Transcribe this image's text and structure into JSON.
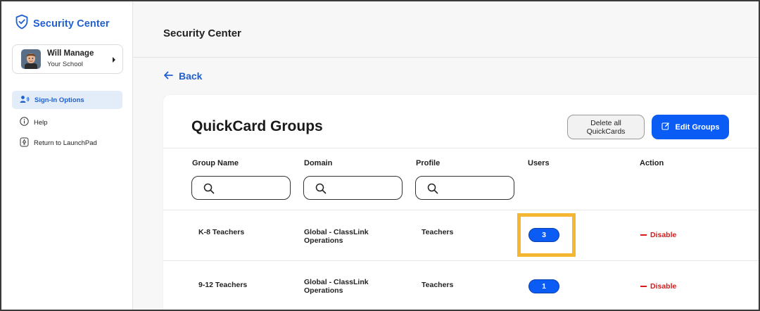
{
  "app": {
    "brand": "Security Center"
  },
  "user": {
    "name": "Will Manage",
    "school": "Your School"
  },
  "sidebar": {
    "items": [
      {
        "label": "Sign-In Options",
        "icon": "users-signin-icon",
        "active": true
      },
      {
        "label": "Help",
        "icon": "info-icon",
        "active": false
      },
      {
        "label": "Return to LaunchPad",
        "icon": "launchpad-icon",
        "active": false
      }
    ]
  },
  "header": {
    "title": "Security Center"
  },
  "nav": {
    "back_label": "Back"
  },
  "card": {
    "title": "QuickCard Groups",
    "delete_label_line1": "Delete all",
    "delete_label_line2": "QuickCards",
    "edit_label": "Edit Groups"
  },
  "table": {
    "columns": [
      "Group Name",
      "Domain",
      "Profile",
      "Users",
      "Action"
    ],
    "rows": [
      {
        "group": "K-8 Teachers",
        "domain_line1": "Global - ClassLink",
        "domain_line2": "Operations",
        "profile": "Teachers",
        "users": "3",
        "action": "Disable"
      },
      {
        "group": "9-12 Teachers",
        "domain_line1": "Global - ClassLink",
        "domain_line2": "Operations",
        "profile": "Teachers",
        "users": "1",
        "action": "Disable"
      }
    ]
  },
  "colors": {
    "accent": "#1f5fd1",
    "button_blue": "#0b5cf5",
    "danger": "#d61b1b",
    "highlight": "#f5b731"
  }
}
